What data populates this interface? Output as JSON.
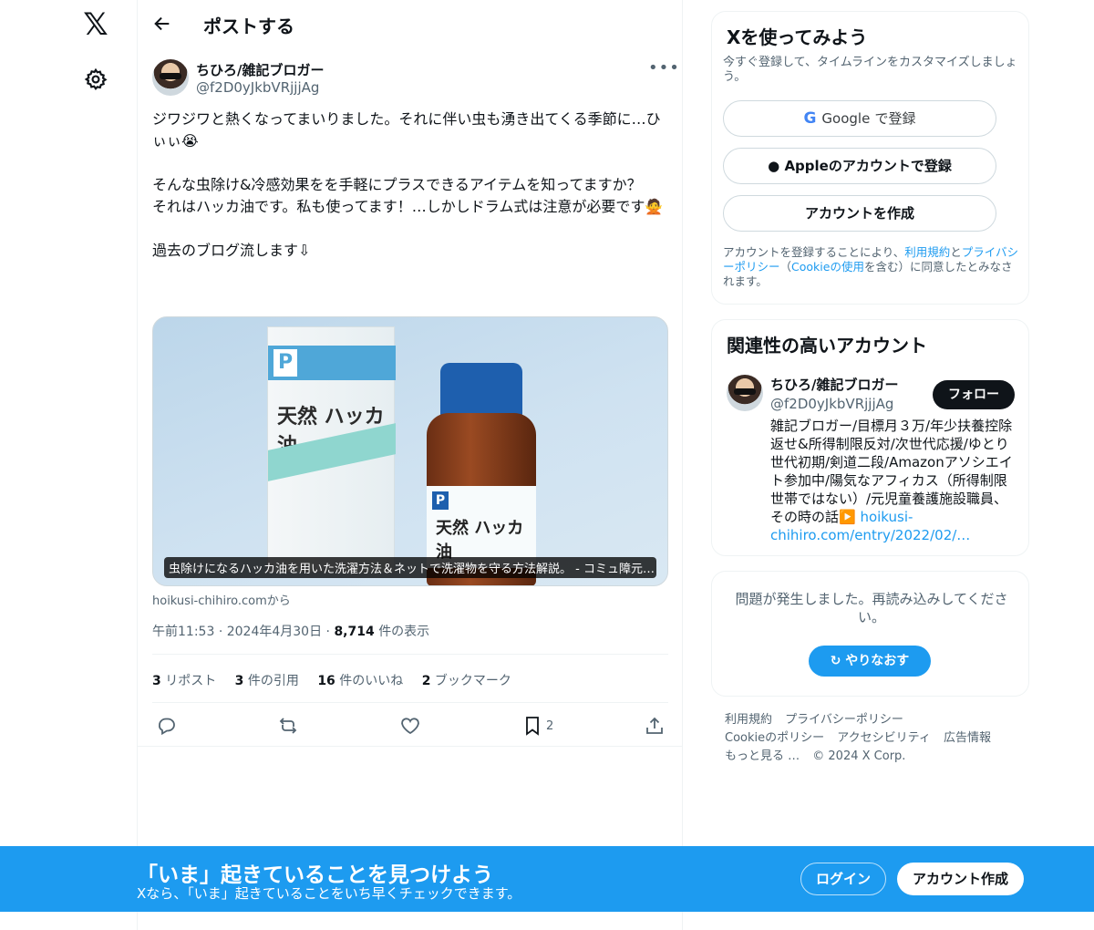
{
  "nav": {
    "logo": "𝕏"
  },
  "header": {
    "title": "ポストする"
  },
  "post": {
    "author_name": "ちひろ/雑記ブロガー",
    "author_handle": "@f2D0yJkbVRjjjAg",
    "more": "•••",
    "text": "ジワジワと熱くなってまいりました。それに伴い虫も湧き出てくる季節に…ひぃぃ😭\n\nそんな虫除け&冷感効果をを手軽にプラスできるアイテムを知ってますか？\nそれはハッカ油です。私も使ってます！…しかしドラム式は注意が必要です🙅\n\n過去のブログ流します⇩",
    "media_caption": "虫除けになるハッカ油を用いた洗濯方法＆ネットで洗濯物を守る方法解説。 - コミュ障元…",
    "media_product_label": "天然 ハッカ油",
    "media_bottle_label": "天然 ハッカ油",
    "media_p": "P",
    "source": "hoikusi-chihiro.comから",
    "time": "午前11:53",
    "date": "2024年4月30日",
    "views_count": "8,714",
    "views_label": "件の表示",
    "sep": "·",
    "stats": {
      "reposts_count": "3",
      "reposts_label": "リポスト",
      "quotes_count": "3",
      "quotes_label": "件の引用",
      "likes_count": "16",
      "likes_label": "件のいいね",
      "bookmarks_count": "2",
      "bookmarks_label": "ブックマーク"
    },
    "bookmark_action_count": "2"
  },
  "signup": {
    "title": "Xを使ってみよう",
    "subtitle": "今すぐ登録して、タイムラインをカスタマイズしましょう。",
    "google_label": "Google で登録",
    "google_brand": "Google",
    "google_suffix": "で登録",
    "apple_label": "Appleのアカウントで登録",
    "create_label": "アカウントを作成",
    "legal_pre": "アカウントを登録することにより、",
    "legal_terms": "利用規約",
    "legal_and": "と",
    "legal_privacy": "プライバシーポリシー",
    "legal_cookie_pre": "（",
    "legal_cookie": "Cookieの使用",
    "legal_post": "を含む）に同意したとみなされます。"
  },
  "related": {
    "title": "関連性の高いアカウント",
    "name": "ちひろ/雑記ブロガー",
    "handle": "@f2D0yJkbVRjjjAg",
    "follow": "フォロー",
    "bio": "雑記ブロガー/目標月３万/年少扶養控除返せ&所得制限反対/次世代応援/ゆとり世代初期/剣道二段/Amazonアソシエイト参加中/陽気なアフィカス（所得制限世帯ではない）/元児童養護施設職員、その時の話▶️ ",
    "bio_link": "hoikusi-chihiro.com/entry/2022/02/…"
  },
  "error": {
    "message": "問題が発生しました。再読み込みしてください。",
    "retry": "やりなおす"
  },
  "footer": {
    "terms": "利用規約",
    "privacy": "プライバシーポリシー",
    "cookie": "Cookieのポリシー",
    "accessibility": "アクセシビリティ",
    "ads": "広告情報",
    "more": "もっと見る …",
    "copyright": "© 2024 X Corp."
  },
  "banner": {
    "title": "「いま」起きていることを見つけよう",
    "subtitle": "Xなら、「いま」起きていることをいち早くチェックできます。",
    "login": "ログイン",
    "signup": "アカウント作成"
  },
  "colors": {
    "accent": "#1d9bf0",
    "text": "#0f1419",
    "muted": "#536471",
    "border": "#eff3f4"
  },
  "icons": {
    "back": "arrow-left-icon",
    "settings": "gear-icon",
    "reply": "reply-icon",
    "repost": "repost-icon",
    "like": "heart-icon",
    "bookmark": "bookmark-icon",
    "share": "share-icon",
    "apple": "apple-icon",
    "google": "google-icon",
    "refresh": "refresh-icon"
  }
}
